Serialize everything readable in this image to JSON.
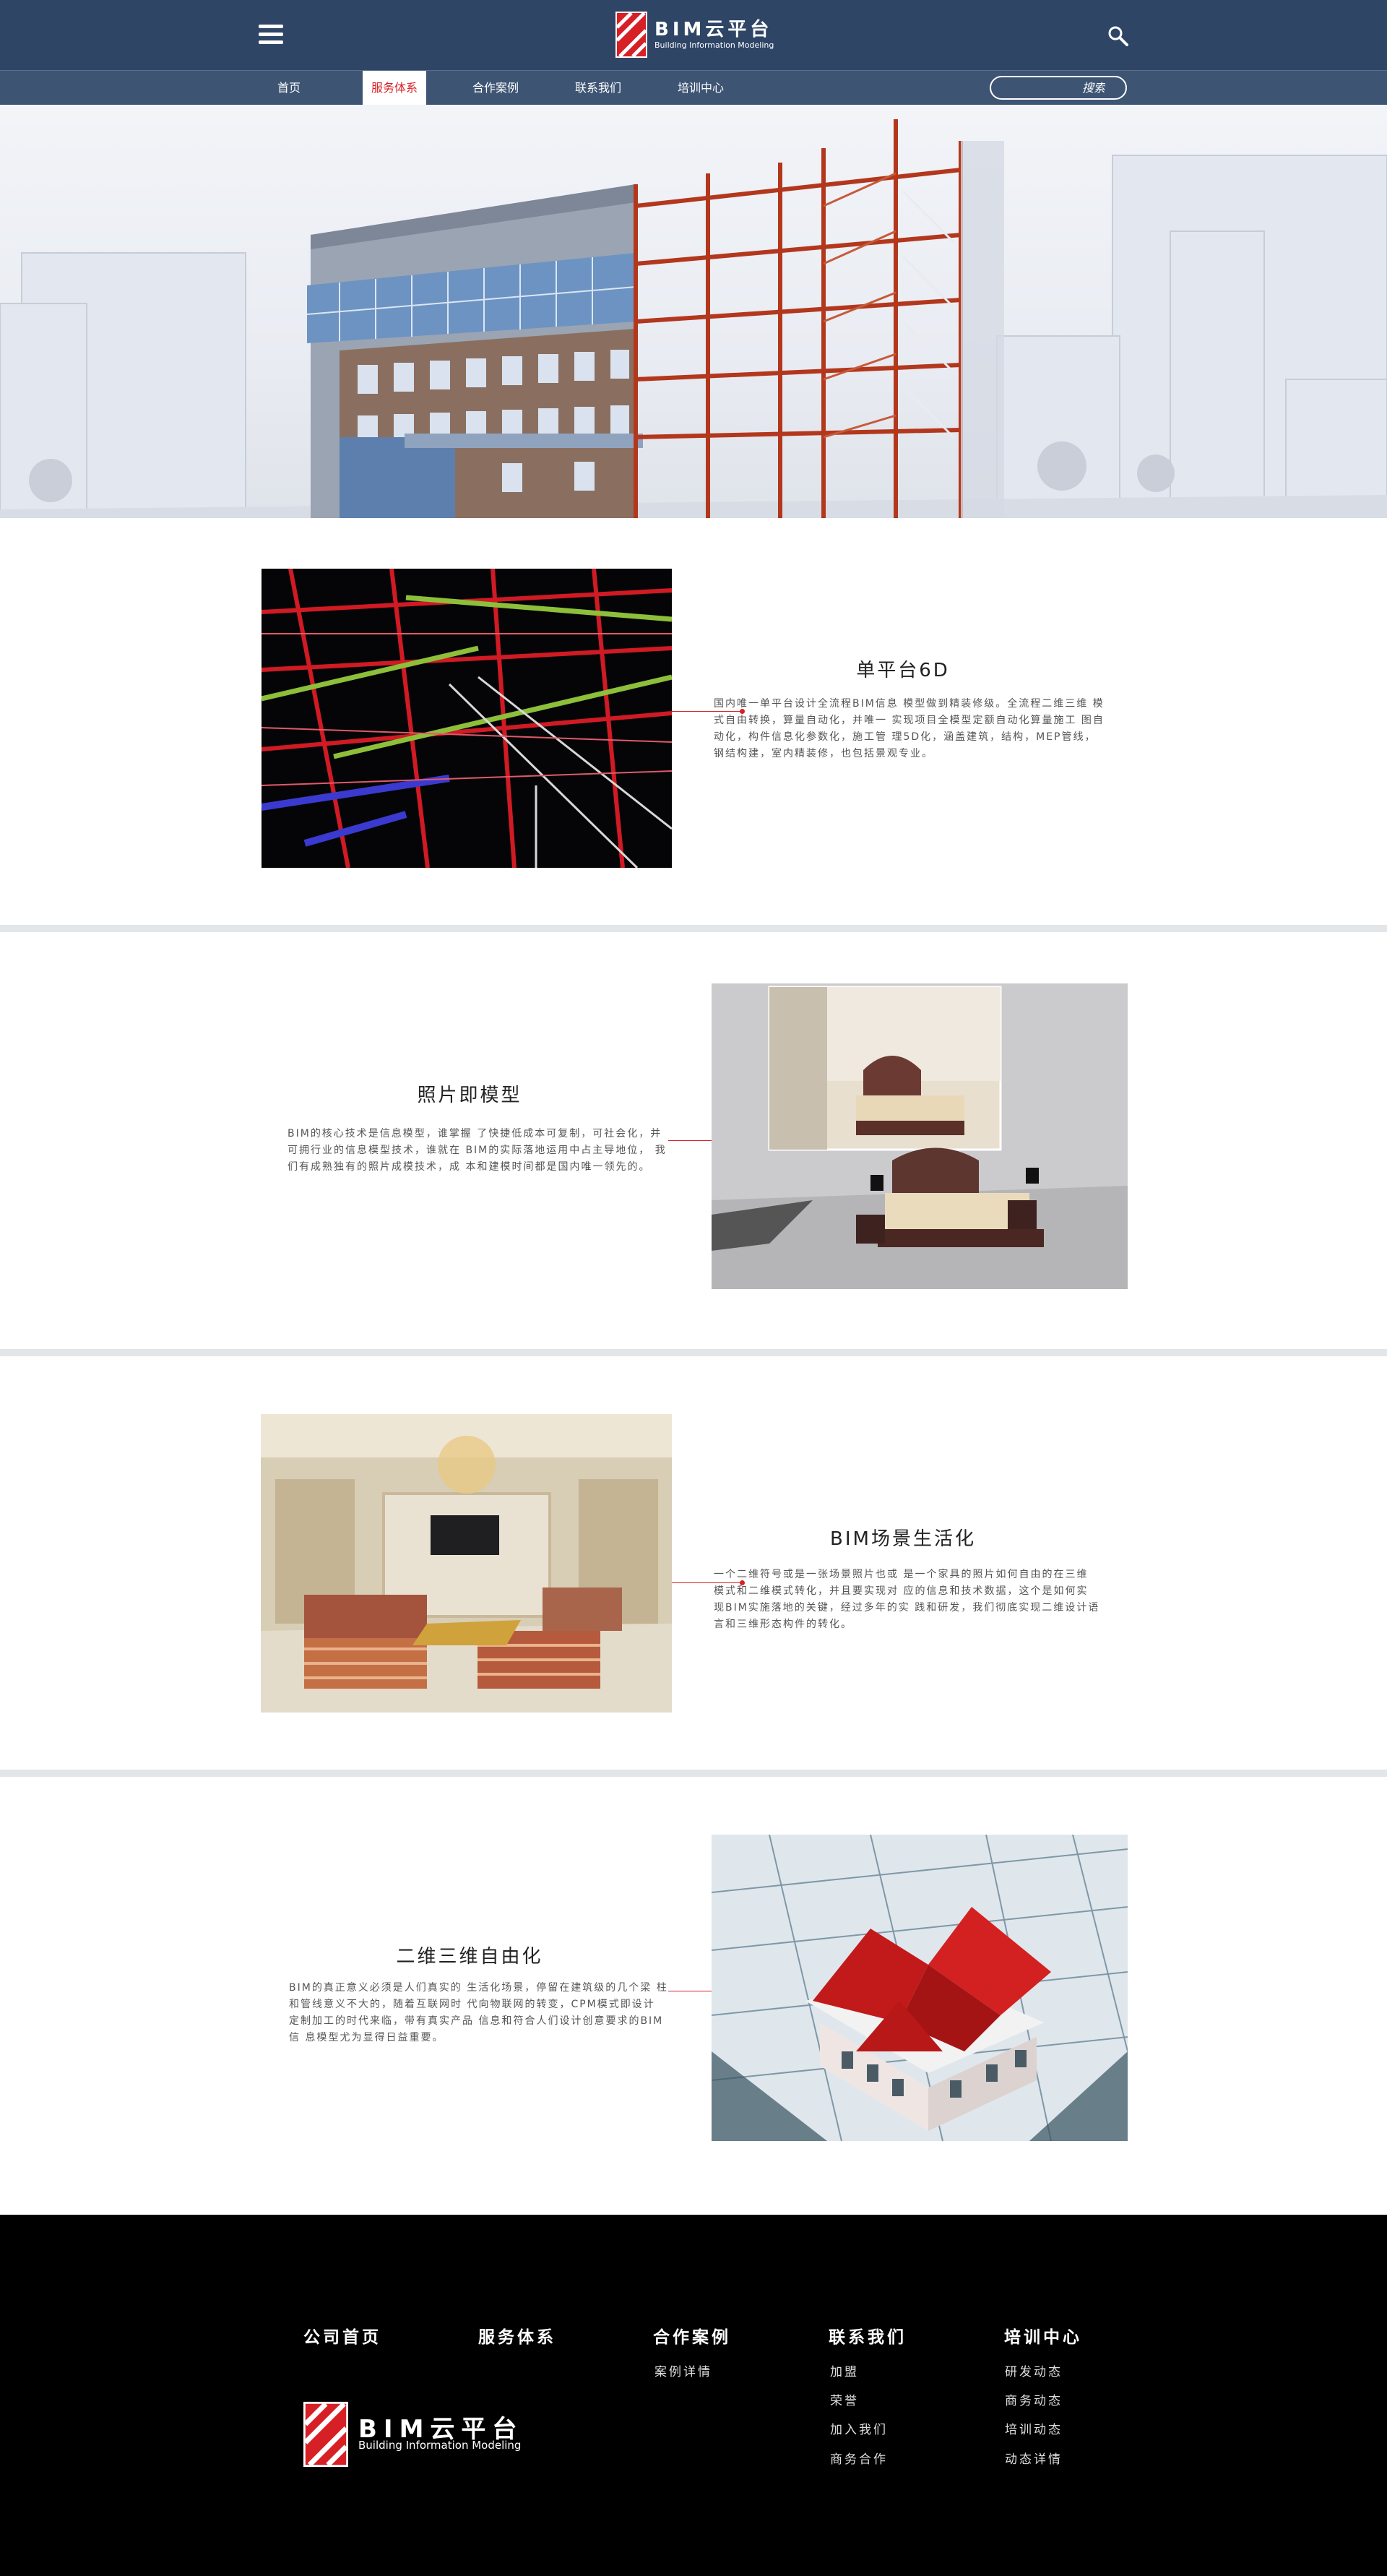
{
  "header": {
    "brand_title": "BIM云平台",
    "brand_subtitle": "Building Information Modeling"
  },
  "nav": {
    "items": [
      {
        "label": "首页",
        "active": false
      },
      {
        "label": "服务体系",
        "active": true
      },
      {
        "label": "合作案例",
        "active": false
      },
      {
        "label": "联系我们",
        "active": false
      },
      {
        "label": "培训中心",
        "active": false
      }
    ],
    "search_placeholder": "搜索"
  },
  "features": [
    {
      "title": "单平台6D",
      "desc": "国内唯一单平台设计全流程BIM信息 模型做到精装修级。全流程二维三维 模式自由转换，算量自动化，并唯一 实现项目全模型定额自动化算量施工 图自动化，构件信息化参数化，施工管 理5D化，涵盖建筑，结构，MEP管线， 钢结构建，室内精装修，也包括景观专业。"
    },
    {
      "title": "照片即模型",
      "desc": "BIM的核心技术是信息模型，谁掌握 了快捷低成本可复制，可社会化，并 可拥行业的信息模型技术，谁就在 BIM的实际落地运用中占主导地位， 我们有成熟独有的照片成模技术，成 本和建模时间都是国内唯一领先的。"
    },
    {
      "title": "BIM场景生活化",
      "desc": "一个二维符号或是一张场景照片也或 是一个家具的照片如何自由的在三维 模式和二维模式转化，并且要实现对 应的信息和技术数据，这个是如何实 现BIM实施落地的关键，经过多年的实 践和研发，我们彻底实现二维设计语 言和三维形态构件的转化。"
    },
    {
      "title": "二维三维自由化",
      "desc": "BIM的真正意义必须是人们真实的 生活化场景，停留在建筑级的几个梁 柱和管线意义不大的，随着互联网时 代向物联网的转变，CPM模式即设计 定制加工的时代来临，带有真实产品 信息和符合人们设计创意要求的BIM信 息模型尤为显得日益重要。"
    }
  ],
  "footer": {
    "columns": [
      {
        "heading": "公司首页",
        "links": []
      },
      {
        "heading": "服务体系",
        "links": []
      },
      {
        "heading": "合作案例",
        "links": [
          "案例详情"
        ]
      },
      {
        "heading": "联系我们",
        "links": [
          "加盟",
          "荣誉",
          "加入我们",
          "商务合作"
        ]
      },
      {
        "heading": "培训中心",
        "links": [
          "研发动态",
          "商务动态",
          "培训动态",
          "动态详情"
        ]
      }
    ],
    "brand_title": "BIM云平台",
    "brand_subtitle": "Building Information Modeling"
  },
  "colors": {
    "header_bg": "#2e4566",
    "nav_bg": "#3d5473",
    "accent_red": "#d71f26",
    "footer_bg": "#000000"
  },
  "icons": [
    "menu-icon",
    "logo-icon",
    "search-icon"
  ]
}
